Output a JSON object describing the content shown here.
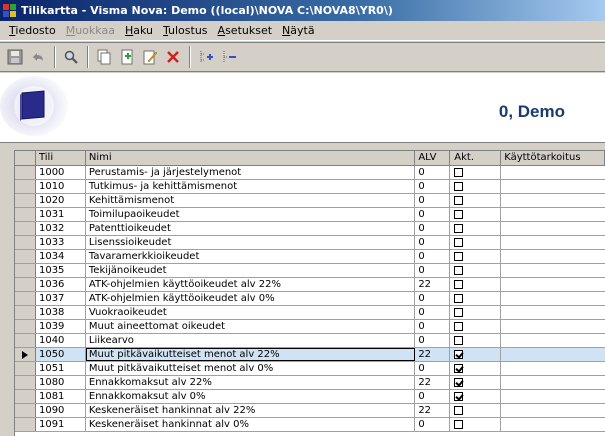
{
  "window": {
    "title": "Tilikartta - Visma Nova: Demo ((local)\\NOVA C:\\NOVA8\\YR0\\)"
  },
  "menu": [
    {
      "label": "Tiedosto",
      "enabled": true
    },
    {
      "label": "Muokkaa",
      "enabled": false
    },
    {
      "label": "Haku",
      "enabled": true
    },
    {
      "label": "Tulostus",
      "enabled": true
    },
    {
      "label": "Asetukset",
      "enabled": true
    },
    {
      "label": "Näytä",
      "enabled": true
    }
  ],
  "toolbar": [
    "save-icon",
    "undo-icon",
    "search-icon",
    "copy-page-icon",
    "new-page-icon",
    "edit-icon",
    "delete-icon",
    "expand-tree-icon",
    "collapse-tree-icon"
  ],
  "banner": {
    "company": "0, Demo"
  },
  "grid": {
    "columns": [
      "Tili",
      "Nimi",
      "ALV",
      "Akt.",
      "Käyttötarkoitus"
    ],
    "rows": [
      {
        "tili": "1000",
        "nimi": "Perustamis- ja järjestelymenot",
        "alv": "0",
        "akt": false
      },
      {
        "tili": "1010",
        "nimi": "Tutkimus- ja kehittämismenot",
        "alv": "0",
        "akt": false
      },
      {
        "tili": "1020",
        "nimi": "Kehittämismenot",
        "alv": "0",
        "akt": false
      },
      {
        "tili": "1031",
        "nimi": "Toimilupaoikeudet",
        "alv": "0",
        "akt": false
      },
      {
        "tili": "1032",
        "nimi": "Patenttioikeudet",
        "alv": "0",
        "akt": false
      },
      {
        "tili": "1033",
        "nimi": "Lisenssioikeudet",
        "alv": "0",
        "akt": false
      },
      {
        "tili": "1034",
        "nimi": "Tavaramerkkioikeudet",
        "alv": "0",
        "akt": false
      },
      {
        "tili": "1035",
        "nimi": "Tekijänoikeudet",
        "alv": "0",
        "akt": false
      },
      {
        "tili": "1036",
        "nimi": "ATK-ohjelmien käyttöoikeudet alv 22%",
        "alv": "22",
        "akt": false
      },
      {
        "tili": "1037",
        "nimi": "ATK-ohjelmien käyttöoikeudet alv 0%",
        "alv": "0",
        "akt": false
      },
      {
        "tili": "1038",
        "nimi": "Vuokraoikeudet",
        "alv": "0",
        "akt": false
      },
      {
        "tili": "1039",
        "nimi": "Muut aineettomat oikeudet",
        "alv": "0",
        "akt": false
      },
      {
        "tili": "1040",
        "nimi": "Liikearvo",
        "alv": "0",
        "akt": false
      },
      {
        "tili": "1050",
        "nimi": "Muut pitkävaikutteiset menot alv 22%",
        "alv": "22",
        "akt": true,
        "selected": true
      },
      {
        "tili": "1051",
        "nimi": "Muut pitkävaikutteiset menot alv 0%",
        "alv": "0",
        "akt": true
      },
      {
        "tili": "1080",
        "nimi": "Ennakkomaksut alv 22%",
        "alv": "22",
        "akt": true
      },
      {
        "tili": "1081",
        "nimi": "Ennakkomaksut alv 0%",
        "alv": "0",
        "akt": true
      },
      {
        "tili": "1090",
        "nimi": "Keskeneräiset hankinnat alv 22%",
        "alv": "22",
        "akt": false
      },
      {
        "tili": "1091",
        "nimi": "Keskeneräiset hankinnat alv 0%",
        "alv": "0",
        "akt": false
      }
    ]
  }
}
